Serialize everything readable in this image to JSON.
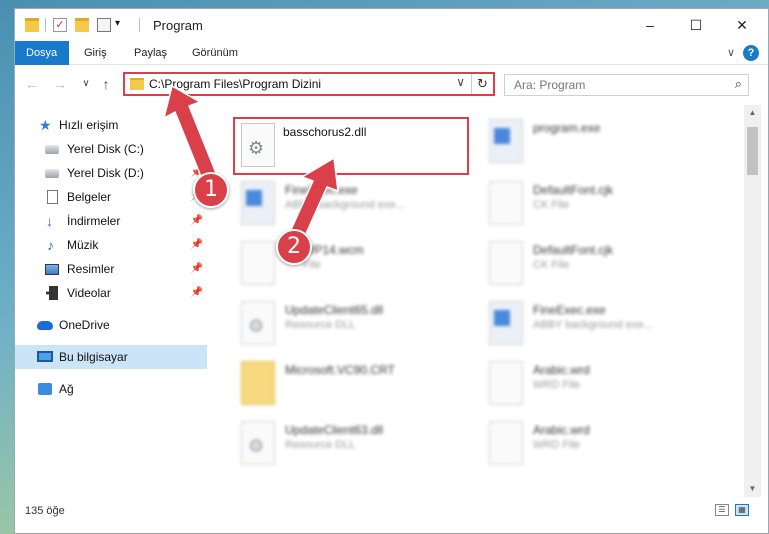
{
  "window": {
    "title": "Program",
    "minimize_glyph": "–",
    "maximize_glyph": "☐",
    "close_glyph": "✕"
  },
  "ribbon": {
    "tabs": [
      {
        "label": "Dosya",
        "active": true
      },
      {
        "label": "Giriş",
        "active": false
      },
      {
        "label": "Paylaş",
        "active": false
      },
      {
        "label": "Görünüm",
        "active": false
      }
    ],
    "expand_glyph": "∨",
    "help_glyph": "?"
  },
  "address": {
    "path": "C:\\Program Files\\Program Dizini",
    "back_glyph": "←",
    "forward_glyph": "→",
    "recent_glyph": "∨",
    "up_glyph": "↑",
    "dropdown_glyph": "∨",
    "refresh_glyph": "↻"
  },
  "search": {
    "placeholder": "Ara: Program",
    "icon_glyph": "⌕"
  },
  "sidebar": {
    "items": [
      {
        "label": "Hızlı erişim",
        "icon": "star-icon",
        "pinned": false
      },
      {
        "label": "Yerel Disk (C:)",
        "icon": "drive-icon",
        "pinned": false
      },
      {
        "label": "Yerel Disk (D:)",
        "icon": "drive-icon",
        "pinned": true
      },
      {
        "label": "Belgeler",
        "icon": "documents-icon",
        "pinned": true
      },
      {
        "label": "İndirmeler",
        "icon": "download-icon",
        "pinned": true
      },
      {
        "label": "Müzik",
        "icon": "music-icon",
        "pinned": true
      },
      {
        "label": "Resimler",
        "icon": "pictures-icon",
        "pinned": true
      },
      {
        "label": "Videolar",
        "icon": "video-icon",
        "pinned": true
      },
      {
        "label": "OneDrive",
        "icon": "cloud-icon",
        "pinned": false
      },
      {
        "label": "Bu bilgisayar",
        "icon": "computer-icon",
        "pinned": false,
        "selected": true
      },
      {
        "label": "Ağ",
        "icon": "network-icon",
        "pinned": false
      }
    ],
    "pin_glyph": "📌"
  },
  "files": [
    {
      "name": "basschorus2.dll",
      "sub": "",
      "type": "dll",
      "highlighted": true
    },
    {
      "name": "program.exe",
      "sub": "",
      "type": "exe"
    },
    {
      "name": "FineExec.exe",
      "sub": "ABBY background exe...",
      "type": "exe"
    },
    {
      "name": "DefaultFont.cjk",
      "sub": "CK File",
      "type": "file"
    },
    {
      "name": "WP14.wcm",
      "sub": "File",
      "type": "file"
    },
    {
      "name": "DefaultFont.cjk",
      "sub": "CK File",
      "type": "file"
    },
    {
      "name": "UpdateClient65.dll",
      "sub": "Resource DLL",
      "type": "dll"
    },
    {
      "name": "FineExec.exe",
      "sub": "ABBY background exe...",
      "type": "exe"
    },
    {
      "name": "Microsoft.VC90.CRT",
      "sub": "",
      "type": "folder"
    },
    {
      "name": "Arabic.wrd",
      "sub": "WRD File",
      "type": "file"
    },
    {
      "name": "UpdateClient63.dll",
      "sub": "Resource DLL",
      "type": "dll"
    },
    {
      "name": "Arabic.wrd",
      "sub": "WRD File",
      "type": "file"
    }
  ],
  "status": {
    "item_count": "135 öğe"
  },
  "annotations": {
    "badge_1": "1",
    "badge_2": "2"
  },
  "colors": {
    "accent": "#1979ca",
    "annotation_red": "#d9404a",
    "selection": "#cce4f7"
  }
}
